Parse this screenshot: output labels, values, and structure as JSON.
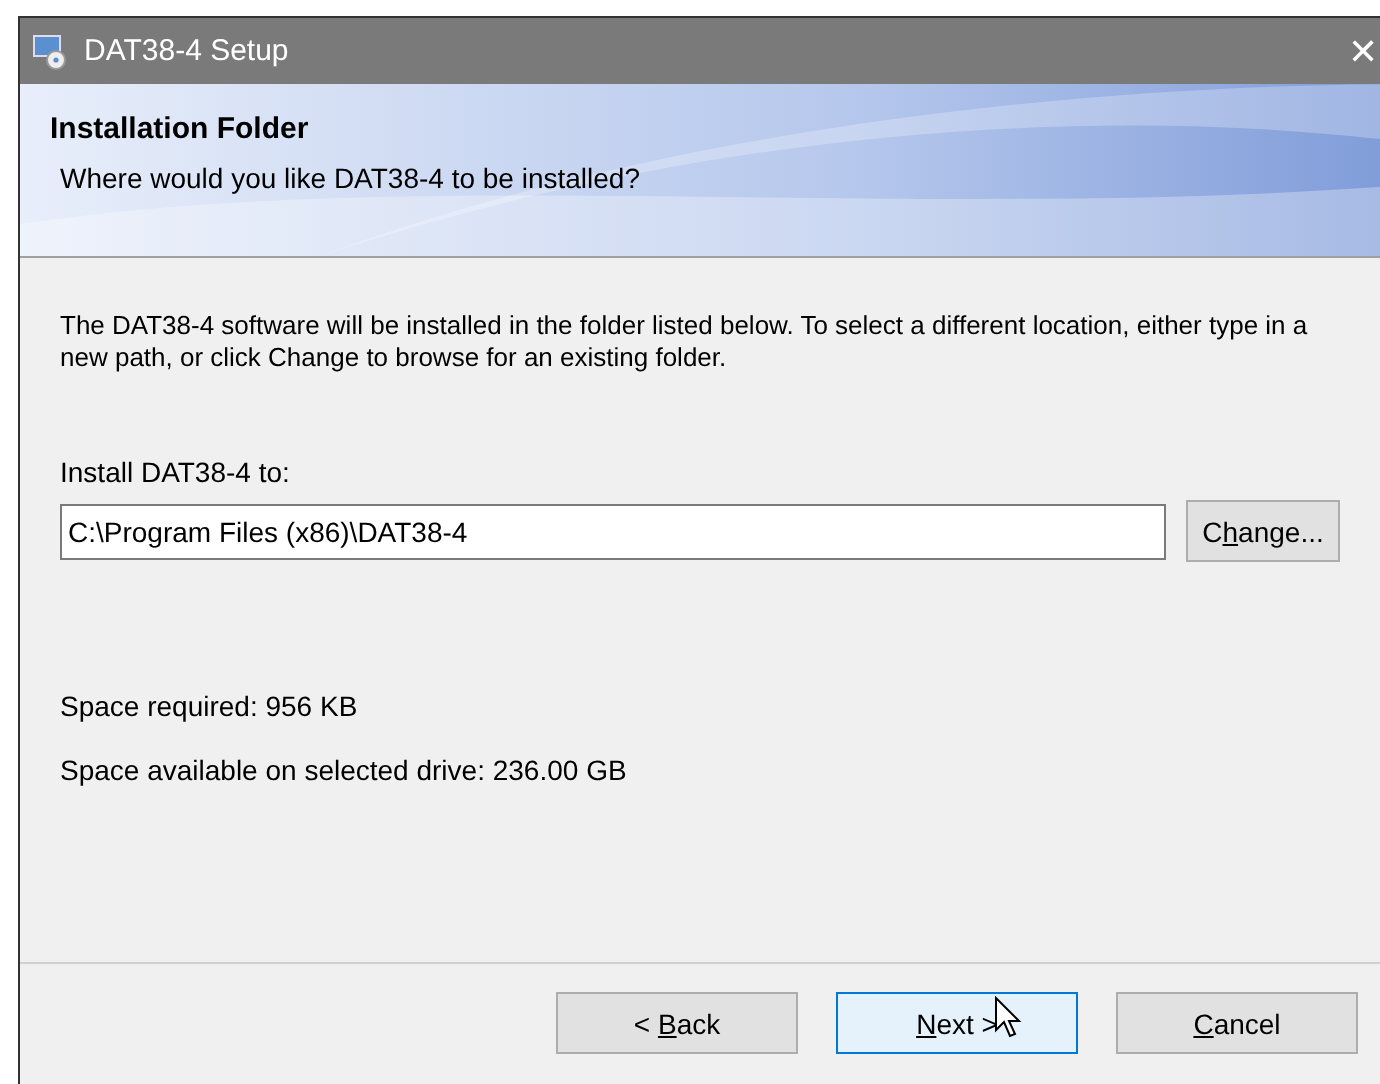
{
  "window": {
    "title": "DAT38-4 Setup",
    "close": "✕"
  },
  "banner": {
    "title": "Installation Folder",
    "subtitle": "Where would you like DAT38-4 to be installed?"
  },
  "description": "The DAT38-4 software will be installed in the folder listed below. To select a different location, either type in a new path, or click Change to browse for an existing folder.",
  "install_label": "Install DAT38-4 to:",
  "path_field": {
    "value": "C:\\Program Files (x86)\\DAT38-4"
  },
  "change_button": {
    "before": "C",
    "key": "h",
    "after": "ange..."
  },
  "space_required": "Space required: 956 KB",
  "space_available": "Space available on selected drive: 236.00 GB",
  "buttons": [
    {
      "before": "< ",
      "key": "B",
      "after": "ack",
      "hovered": false
    },
    {
      "key": "N",
      "after": "ext >",
      "hovered": true
    },
    {
      "key": "C",
      "after": "ancel",
      "hovered": false
    }
  ]
}
